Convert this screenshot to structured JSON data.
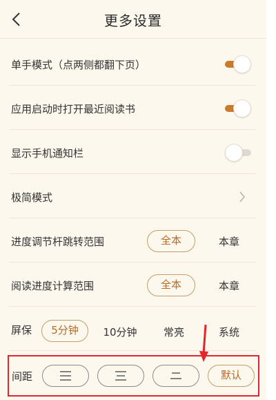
{
  "header": {
    "title": "更多设置"
  },
  "settings": {
    "one_hand": {
      "label": "单手模式（点两侧都翻下页）",
      "enabled": true
    },
    "open_recent": {
      "label": "应用启动时打开最近阅读书",
      "enabled": true
    },
    "notification_bar": {
      "label": "显示手机通知栏",
      "enabled": false
    },
    "minimal_mode": {
      "label": "极简模式"
    },
    "progress_jump": {
      "label": "进度调节杆跳转范围",
      "options": [
        "全本",
        "本章"
      ],
      "selected": "全本"
    },
    "progress_calc": {
      "label": "阅读进度计算范围",
      "options": [
        "全本",
        "本章"
      ],
      "selected": "全本"
    },
    "screen_timeout": {
      "label": "屏保",
      "options": [
        "5分钟",
        "10分钟",
        "常亮",
        "系统"
      ],
      "selected": "5分钟"
    },
    "line_spacing": {
      "label": "间距",
      "default_label": "默认",
      "options": [
        "wide",
        "medium",
        "narrow",
        "default"
      ]
    }
  },
  "colors": {
    "accent": "#c97a2b",
    "background": "#fcf8ee",
    "highlight_box": "#e3262b"
  }
}
